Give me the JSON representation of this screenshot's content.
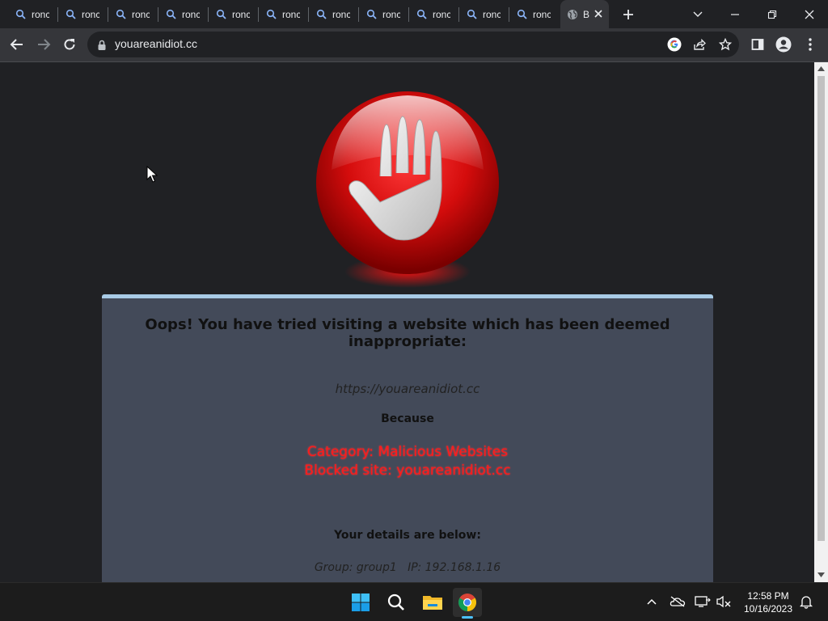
{
  "browser": {
    "tabs": [
      {
        "label": "ronc",
        "icon": "search-icon"
      },
      {
        "label": "ronc",
        "icon": "search-icon"
      },
      {
        "label": "ronc",
        "icon": "search-icon"
      },
      {
        "label": "ronc",
        "icon": "search-icon"
      },
      {
        "label": "ronc",
        "icon": "search-icon"
      },
      {
        "label": "ronc",
        "icon": "search-icon"
      },
      {
        "label": "ronc",
        "icon": "search-icon"
      },
      {
        "label": "ronc",
        "icon": "search-icon"
      },
      {
        "label": "ronc",
        "icon": "search-icon"
      },
      {
        "label": "ronc",
        "icon": "search-icon"
      },
      {
        "label": "ronc",
        "icon": "search-icon"
      }
    ],
    "active_tab": {
      "label": "B",
      "icon": "globe-icon"
    },
    "url": "youareanidiot.cc"
  },
  "page": {
    "title": "Oops! You have tried visiting a website which has been deemed inappropriate:",
    "blocked_url": "https://youareanidiot.cc",
    "because": "Because",
    "category": "Category: Malicious Websites",
    "blocked_site": "Blocked site: youareanidiot.cc",
    "details_heading": "Your details are below:",
    "group_line": "Group: group1   IP: 192.168.1.16"
  },
  "taskbar": {
    "time": "12:58 PM",
    "date": "10/16/2023"
  },
  "colors": {
    "accent": "#a8cbe6",
    "alert_red": "#ff1a1a",
    "card_bg": "#434a59",
    "page_bg": "#202124"
  }
}
